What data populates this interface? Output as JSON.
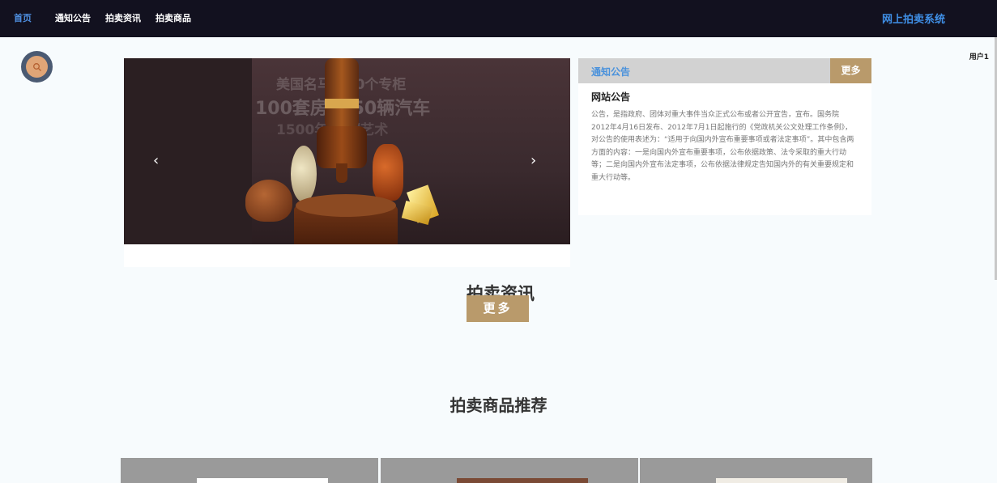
{
  "nav": {
    "items": [
      {
        "label": "首页",
        "active": true
      },
      {
        "label": "通知公告",
        "active": false
      },
      {
        "label": "拍卖资讯",
        "active": false
      },
      {
        "label": "拍卖商品",
        "active": false
      }
    ],
    "brand": "网上拍卖系统"
  },
  "user": {
    "label": "用户1"
  },
  "carousel": {
    "slide_text": [
      "美国名马 100个专柜",
      "100套房子 50辆汽车",
      "1500年 中国艺术"
    ],
    "prev_icon": "chevron-left-icon",
    "next_icon": "chevron-right-icon"
  },
  "notice": {
    "title": "通知公告",
    "more": "更多",
    "item_title": "网站公告",
    "item_body": "公告，是指政府、团体对重大事件当众正式公布或者公开宣告，宣布。国务院2012年4月16日发布、2012年7月1日起施行的《党政机关公文处理工作条例》，对公告的使用表述为：“适用于向国内外宣布重要事项或者法定事项”。其中包含两方面的内容：一是向国内外宣布重要事项，公布依据政策、法令采取的重大行动等；二是向国内外宣布法定事项，公布依据法律规定告知国内外的有关重要规定和重大行动等。"
  },
  "news": {
    "title": "拍卖资讯",
    "more": "更多"
  },
  "goods": {
    "title": "拍卖商品推荐"
  },
  "colors": {
    "nav_bg": "#12111f",
    "brand": "#3f8fe6",
    "accent_gold": "#b99a6b",
    "page_bg": "#f7fbfd"
  }
}
